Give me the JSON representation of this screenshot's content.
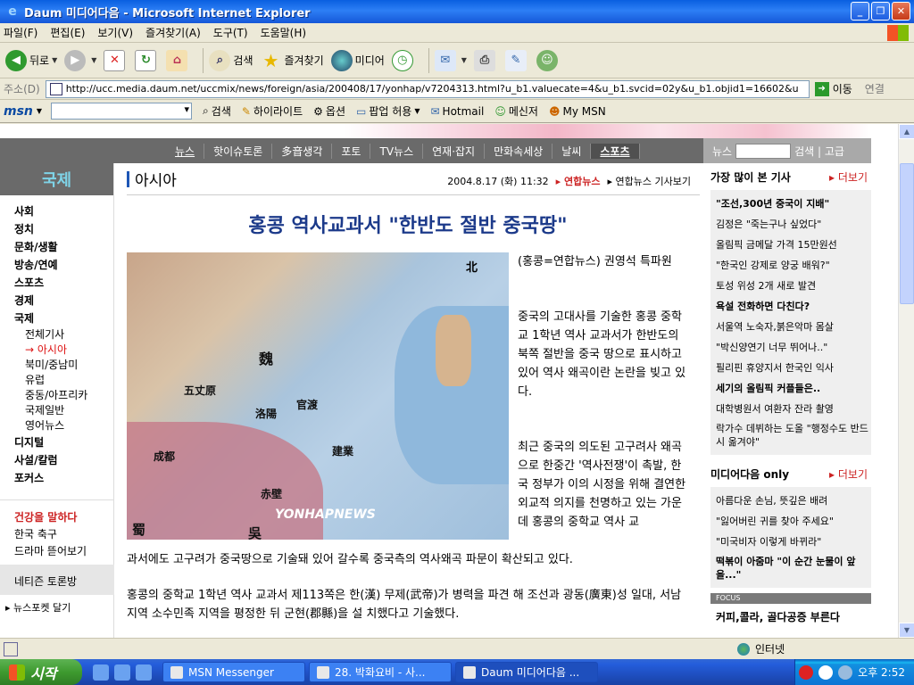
{
  "window": {
    "title": "Daum 미디어다음 - Microsoft Internet Explorer",
    "buttons": [
      "_",
      "❐",
      "✕"
    ]
  },
  "menu": [
    "파일(F)",
    "편집(E)",
    "보기(V)",
    "즐겨찾기(A)",
    "도구(T)",
    "도움말(H)"
  ],
  "toolbar": {
    "back": "뒤로",
    "search": "검색",
    "favorites": "즐겨찾기",
    "media": "미디어"
  },
  "address": {
    "label": "주소(D)",
    "url": "http://ucc.media.daum.net/uccmix/news/foreign/asia/200408/17/yonhap/v7204313.html?u_b1.valuecate=4&u_b1.svcid=02y&u_b1.objid1=16602&u",
    "go": "이동",
    "links": "연결"
  },
  "msnbar": {
    "logo": "msn",
    "search": "검색",
    "highlight": "하이라이트",
    "options": "옵션",
    "popup": "팝업 허용",
    "hotmail": "Hotmail",
    "messenger": "메신저",
    "mymsn": "My MSN"
  },
  "site_nav": {
    "items": [
      "뉴스",
      "핫이슈토론",
      "多音생각",
      "포토",
      "TV뉴스",
      "연재·잡지",
      "만화속세상",
      "날씨",
      "스포츠"
    ],
    "search_label": "뉴스",
    "search_btn": "검색 | 고급"
  },
  "leftnav": {
    "section": "국제",
    "items": [
      "사회",
      "정치",
      "문화/생활",
      "방송/연예",
      "스포츠",
      "경제",
      "국제"
    ],
    "subitems": [
      "전체기사",
      "→ 아시아",
      "북미/중남미",
      "유럽",
      "중동/아프리카",
      "국제일반",
      "영어뉴스"
    ],
    "items2": [
      "디지털",
      "사설/칼럼",
      "포커스"
    ],
    "health": [
      "건강을 말하다",
      "한국 축구",
      "드라마 뜯어보기"
    ],
    "debate": "네티즌 토론방",
    "pocket": "▸ 뉴스포켓 달기"
  },
  "article": {
    "section": "아시아",
    "date": "2004.8.17 (화) 11:32",
    "agency": "▸ 연합뉴스",
    "agency_more": "▸ 연합뉴스 기사보기",
    "headline": "홍콩 역사교과서 \"한반도 절반 중국땅\"",
    "byline": "(홍콩=연합뉴스) 권영석 특파원",
    "p1": "중국의 고대사를 기술한 홍콩 중학교 1학년 역사 교과서가 한반도의 북쪽 절반을 중국 땅으로 표시하고 있어 역사 왜곡이란 논란을 빚고 있다.",
    "p2": "최근 중국의 의도된 고구려사 왜곡으로 한중간 '역사전쟁'이 촉발, 한국 정부가 이의 시정을 위해 결연한 외교적 의지를 천명하고 있는 가운데 홍콩의 중학교 역사 교",
    "p2b": "과서에도 고구려가 중국땅으로 기술돼 있어 갈수록 중국측의 역사왜곡 파문이 확산되고 있다.",
    "p3": "홍콩의 중학교 1학년 역사 교과서 제113쪽은 한(漢) 무제(武帝)가 병력을 파견 해 조선과 광동(廣東)성 일대, 서남지역 소수민족 지역을 평정한 뒤 군현(郡縣)을 설 치했다고 기술했다.",
    "map": {
      "north": "北",
      "cities": [
        "五丈原",
        "洛陽",
        "官渡",
        "魏",
        "成都",
        "建業",
        "赤壁",
        "蜀",
        "吳"
      ],
      "watermark": "YONHAPNEWS"
    }
  },
  "right": {
    "most_viewed": "가장 많이 본 기사",
    "more": "▸ 더보기",
    "list1": [
      "\"조선,300년 중국이 지배\"",
      "김정은 \"죽는구나 싶었다\"",
      "올림픽 금메달 가격 15만원선",
      "\"한국인 강제로 양궁 배워?\"",
      "토성 위성 2개 새로 발견",
      "욕설 전화하면 다친다?",
      "서울역 노숙자,붉은악마 몸살",
      "\"박신양연기 너무 뛰어나..\"",
      "필리핀 휴양지서 한국인 익사",
      "세기의 올림픽 커플들은..",
      "대학병원서 여환자 잔라 촬영",
      "락가수 데뷔하는 도올 \"행정수도 반드시 옮겨야\""
    ],
    "media_only": "미디어다음 only",
    "list2": [
      "아름다운 손님, 뜻깊은 배려",
      "\"잃어버린 귀를 찾아 주세요\"",
      "\"미국비자 이렇게 바뀌라\"",
      "떡볶이 아줌마 \"이 순간 눈물이 앞을...\""
    ],
    "focus": "FOCUS",
    "focus_text": "커피,콜라, 골다공증 부른다"
  },
  "status": {
    "zone": "인터넷"
  },
  "taskbar": {
    "start": "시작",
    "tasks": [
      "MSN Messenger",
      "28. 박화요비 - 사...",
      "Daum 미디어다음 ..."
    ],
    "clock": "오후 2:52"
  }
}
